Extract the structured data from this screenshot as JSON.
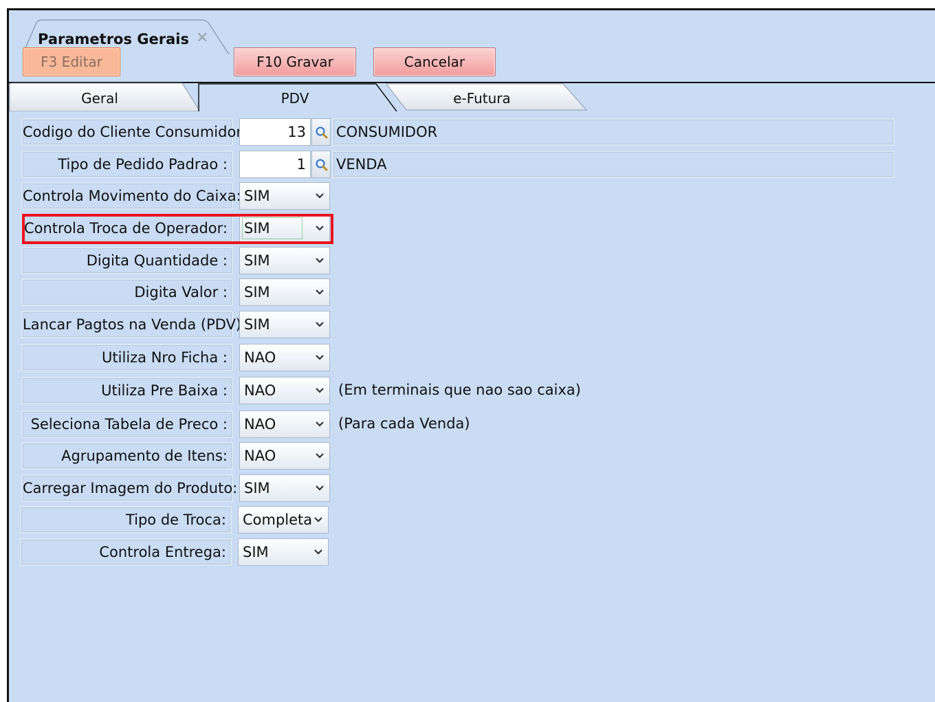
{
  "window_tab": {
    "title": "Parametros Gerais",
    "close_glyph": "✕"
  },
  "toolbar": {
    "edit_label": "F3 Editar",
    "save_label": "F10 Gravar",
    "cancel_label": "Cancelar"
  },
  "tabs": [
    {
      "label": "Geral",
      "active": false
    },
    {
      "label": "PDV",
      "active": true
    },
    {
      "label": "e-Futura",
      "active": false
    }
  ],
  "lookup_fields": [
    {
      "label": "Codigo do Cliente Consumidor:",
      "code": "13",
      "description": "CONSUMIDOR"
    },
    {
      "label": "Tipo de Pedido Padrao :",
      "code": "1",
      "description": "VENDA"
    }
  ],
  "select_fields": [
    {
      "label": "Controla Movimento do Caixa:",
      "value": "SIM",
      "note": ""
    },
    {
      "label": "Controla Troca de Operador:",
      "value": "SIM",
      "note": "",
      "highlighted": true
    },
    {
      "label": "Digita Quantidade :",
      "value": "SIM",
      "note": ""
    },
    {
      "label": "Digita Valor :",
      "value": "SIM",
      "note": ""
    },
    {
      "label": "Lancar Pagtos na Venda (PDV) :",
      "value": "SIM",
      "note": ""
    },
    {
      "label": "Utiliza Nro Ficha :",
      "value": "NAO",
      "note": ""
    },
    {
      "label": "Utiliza Pre Baixa :",
      "value": "NAO",
      "note": "(Em terminais que nao sao caixa)"
    },
    {
      "label": "Seleciona Tabela de Preco :",
      "value": "NAO",
      "note": "(Para cada Venda)"
    },
    {
      "label": "Agrupamento de Itens:",
      "value": "NAO",
      "note": ""
    },
    {
      "label": "Carregar Imagem do Produto:",
      "value": "SIM",
      "note": ""
    },
    {
      "label": "Tipo de Troca:",
      "value": "Completa",
      "note": ""
    },
    {
      "label": "Controla Entrega:",
      "value": "SIM",
      "note": ""
    }
  ],
  "colors": {
    "background": "#c9dcf4",
    "highlight": "#e8141e",
    "edit_button": "#f9b898",
    "action_button": "#f29c9c"
  }
}
